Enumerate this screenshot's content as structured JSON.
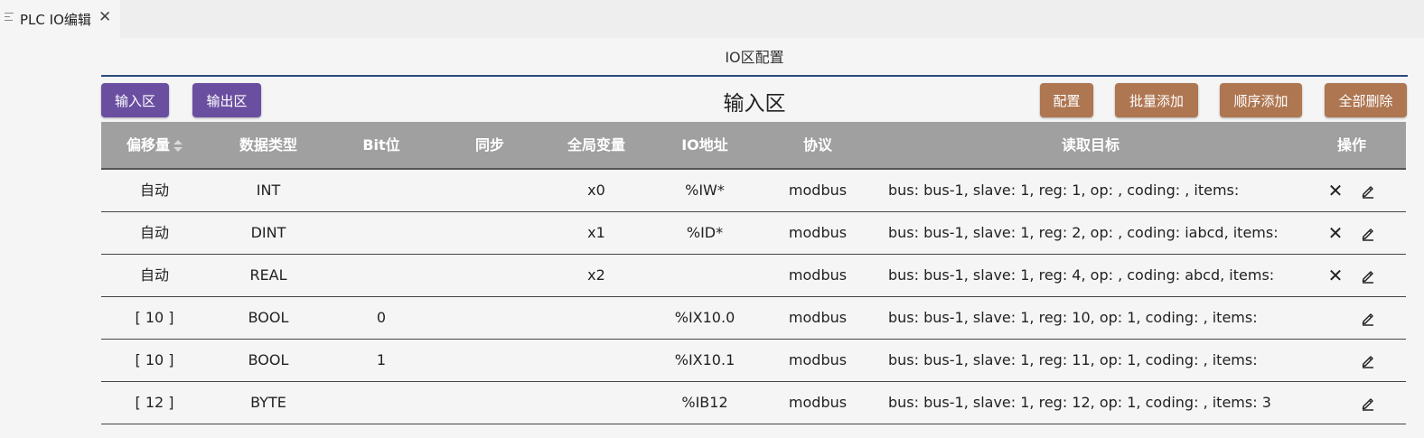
{
  "tab": {
    "title": "PLC IO编辑",
    "close_glyph": "✕",
    "icon": "list-icon"
  },
  "page": {
    "title": "IO区配置"
  },
  "toolbar": {
    "input_zone_label": "输入区",
    "output_zone_label": "输出区",
    "section_title": "输入区",
    "config_label": "配置",
    "batch_add_label": "批量添加",
    "seq_add_label": "顺序添加",
    "delete_all_label": "全部删除"
  },
  "table": {
    "headers": {
      "offset": "偏移量",
      "dtype": "数据类型",
      "bit": "Bit位",
      "sync": "同步",
      "global_var": "全局变量",
      "io_addr": "IO地址",
      "protocol": "协议",
      "target": "读取目标",
      "ops": "操作"
    },
    "rows": [
      {
        "offset": "自动",
        "dtype": "INT",
        "bit": "",
        "sync": "",
        "global_var": "x0",
        "io_addr": "%IW*",
        "protocol": "modbus",
        "target": "bus: bus-1,  slave: 1,  reg: 1,  op: ,  coding: ,  items:",
        "has_delete": true
      },
      {
        "offset": "自动",
        "dtype": "DINT",
        "bit": "",
        "sync": "",
        "global_var": "x1",
        "io_addr": "%ID*",
        "protocol": "modbus",
        "target": "bus: bus-1,  slave: 1,  reg: 2,  op: ,  coding: iabcd,  items:",
        "has_delete": true
      },
      {
        "offset": "自动",
        "dtype": "REAL",
        "bit": "",
        "sync": "",
        "global_var": "x2",
        "io_addr": "",
        "protocol": "modbus",
        "target": "bus: bus-1,  slave: 1,  reg: 4,  op: ,  coding: abcd,  items:",
        "has_delete": true
      },
      {
        "offset": "[ 10 ]",
        "dtype": "BOOL",
        "bit": "0",
        "sync": "",
        "global_var": "",
        "io_addr": "%IX10.0",
        "protocol": "modbus",
        "target": "bus: bus-1,  slave: 1,  reg: 10,  op: 1,  coding: ,  items:",
        "has_delete": false
      },
      {
        "offset": "[ 10 ]",
        "dtype": "BOOL",
        "bit": "1",
        "sync": "",
        "global_var": "",
        "io_addr": "%IX10.1",
        "protocol": "modbus",
        "target": "bus: bus-1,  slave: 1,  reg: 11,  op: 1,  coding: ,  items:",
        "has_delete": false
      },
      {
        "offset": "[ 12 ]",
        "dtype": "BYTE",
        "bit": "",
        "sync": "",
        "global_var": "",
        "io_addr": "%IB12",
        "protocol": "modbus",
        "target": "bus: bus-1,  slave: 1,  reg: 12,  op: 1,  coding: ,  items: 3",
        "has_delete": false
      }
    ]
  },
  "colors": {
    "purple_button": "#6a4fa1",
    "brown_button": "#ae7651",
    "header_bg": "#a0a0a0",
    "title_rule": "#2c4a7e"
  },
  "icons": {
    "delete": "close-icon",
    "edit": "edit-pencil-icon",
    "sort": "sort-icon"
  }
}
